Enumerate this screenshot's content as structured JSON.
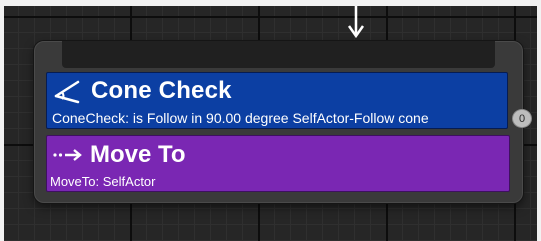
{
  "graph": {
    "incoming_arrow_icon": "arrow-down-icon"
  },
  "decorator": {
    "icon": "cone-check-icon",
    "title": "Cone Check",
    "description": "ConeCheck: is Follow in 90.00 degree SelfActor-Follow cone",
    "color": "#0c3fa3"
  },
  "pin_badge": {
    "value": "0"
  },
  "task": {
    "icon": "move-to-icon",
    "title": "Move To",
    "description": "MoveTo: SelfActor",
    "color": "#7a27b3"
  }
}
